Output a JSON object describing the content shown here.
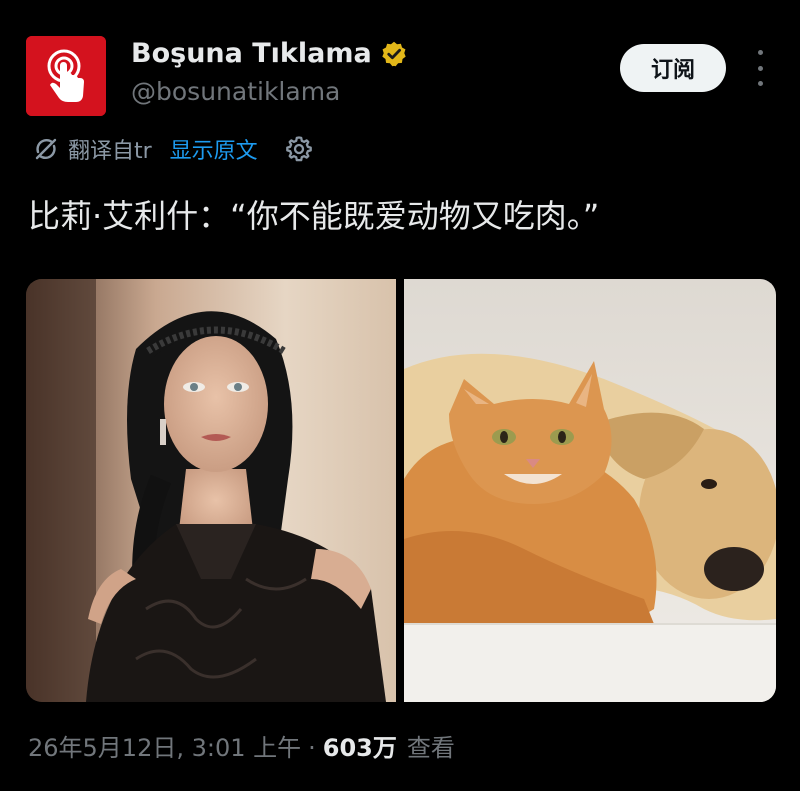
{
  "author": {
    "display_name": "Boşuna Tıklama",
    "handle": "@bosunatiklama",
    "verified_badge_color": "#e2b719",
    "avatar_color": "#d4121e",
    "avatar_icon": "tap-hand-icon"
  },
  "actions": {
    "subscribe_label": "订阅",
    "more_icon": "more-vertical-icon"
  },
  "translation": {
    "translated_from": "翻译自tr",
    "show_original": "显示原文",
    "settings_icon": "gear-icon"
  },
  "tweet": {
    "text": "比莉·艾利什：“你不能既爱动物又吃肉。”"
  },
  "media": [
    {
      "name": "woman-portrait-photo"
    },
    {
      "name": "cat-and-dog-photo"
    }
  ],
  "meta": {
    "timestamp": "26年5月12日, 3:01 上午",
    "separator": "·",
    "views_count": "603万",
    "views_label": "查看"
  },
  "colors": {
    "background": "#000000",
    "link": "#1d9bf0",
    "muted": "#71767b"
  }
}
